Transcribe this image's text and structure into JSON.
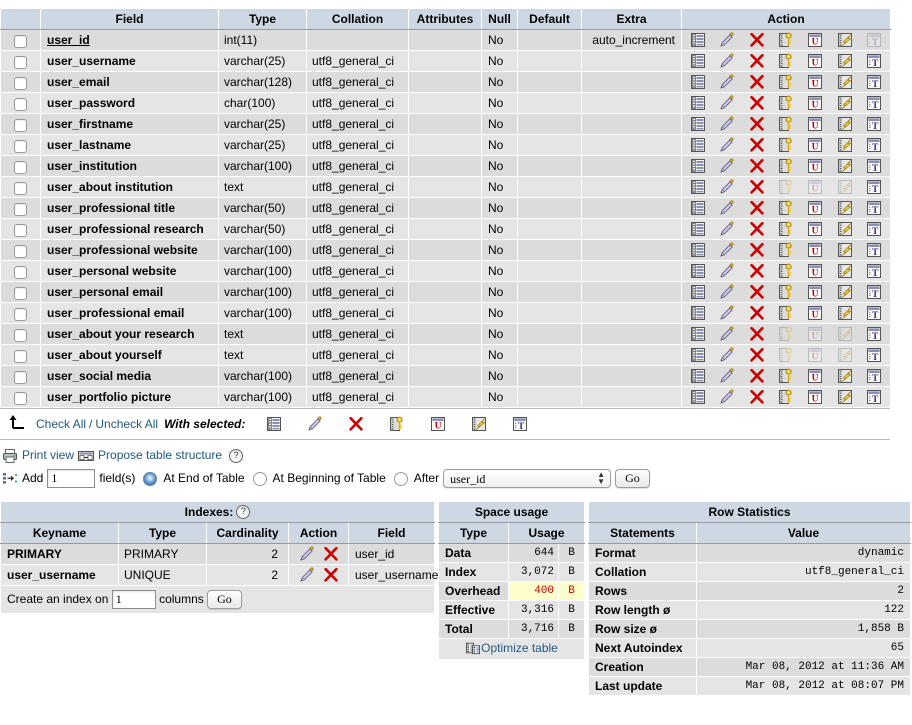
{
  "structure": {
    "columns": [
      "",
      "Field",
      "Type",
      "Collation",
      "Attributes",
      "Null",
      "Default",
      "Extra",
      "Action"
    ],
    "rows": [
      {
        "field": "user_id",
        "type": "int(11)",
        "collation": "",
        "attributes": "",
        "null": "No",
        "default": "",
        "extra": "auto_increment",
        "primary_key": true,
        "disabled": [
          "fulltext"
        ]
      },
      {
        "field": "user_username",
        "type": "varchar(25)",
        "collation": "utf8_general_ci",
        "attributes": "",
        "null": "No",
        "default": "",
        "extra": "",
        "primary_key": false,
        "disabled": []
      },
      {
        "field": "user_email",
        "type": "varchar(128)",
        "collation": "utf8_general_ci",
        "attributes": "",
        "null": "No",
        "default": "",
        "extra": "",
        "primary_key": false,
        "disabled": []
      },
      {
        "field": "user_password",
        "type": "char(100)",
        "collation": "utf8_general_ci",
        "attributes": "",
        "null": "No",
        "default": "",
        "extra": "",
        "primary_key": false,
        "disabled": []
      },
      {
        "field": "user_firstname",
        "type": "varchar(25)",
        "collation": "utf8_general_ci",
        "attributes": "",
        "null": "No",
        "default": "",
        "extra": "",
        "primary_key": false,
        "disabled": []
      },
      {
        "field": "user_lastname",
        "type": "varchar(25)",
        "collation": "utf8_general_ci",
        "attributes": "",
        "null": "No",
        "default": "",
        "extra": "",
        "primary_key": false,
        "disabled": []
      },
      {
        "field": "user_institution",
        "type": "varchar(100)",
        "collation": "utf8_general_ci",
        "attributes": "",
        "null": "No",
        "default": "",
        "extra": "",
        "primary_key": false,
        "disabled": []
      },
      {
        "field": "user_about institution",
        "type": "text",
        "collation": "utf8_general_ci",
        "attributes": "",
        "null": "No",
        "default": "",
        "extra": "",
        "primary_key": false,
        "disabled": [
          "primary",
          "unique",
          "index"
        ]
      },
      {
        "field": "user_professional title",
        "type": "varchar(50)",
        "collation": "utf8_general_ci",
        "attributes": "",
        "null": "No",
        "default": "",
        "extra": "",
        "primary_key": false,
        "disabled": []
      },
      {
        "field": "user_professional research",
        "type": "varchar(50)",
        "collation": "utf8_general_ci",
        "attributes": "",
        "null": "No",
        "default": "",
        "extra": "",
        "primary_key": false,
        "disabled": []
      },
      {
        "field": "user_professional website",
        "type": "varchar(100)",
        "collation": "utf8_general_ci",
        "attributes": "",
        "null": "No",
        "default": "",
        "extra": "",
        "primary_key": false,
        "disabled": []
      },
      {
        "field": "user_personal website",
        "type": "varchar(100)",
        "collation": "utf8_general_ci",
        "attributes": "",
        "null": "No",
        "default": "",
        "extra": "",
        "primary_key": false,
        "disabled": []
      },
      {
        "field": "user_personal email",
        "type": "varchar(100)",
        "collation": "utf8_general_ci",
        "attributes": "",
        "null": "No",
        "default": "",
        "extra": "",
        "primary_key": false,
        "disabled": []
      },
      {
        "field": "user_professional email",
        "type": "varchar(100)",
        "collation": "utf8_general_ci",
        "attributes": "",
        "null": "No",
        "default": "",
        "extra": "",
        "primary_key": false,
        "disabled": []
      },
      {
        "field": "user_about your research",
        "type": "text",
        "collation": "utf8_general_ci",
        "attributes": "",
        "null": "No",
        "default": "",
        "extra": "",
        "primary_key": false,
        "disabled": [
          "primary",
          "unique",
          "index"
        ]
      },
      {
        "field": "user_about yourself",
        "type": "text",
        "collation": "utf8_general_ci",
        "attributes": "",
        "null": "No",
        "default": "",
        "extra": "",
        "primary_key": false,
        "disabled": [
          "primary",
          "unique",
          "index"
        ]
      },
      {
        "field": "user_social media",
        "type": "varchar(100)",
        "collation": "utf8_general_ci",
        "attributes": "",
        "null": "No",
        "default": "",
        "extra": "",
        "primary_key": false,
        "disabled": []
      },
      {
        "field": "user_portfolio picture",
        "type": "varchar(100)",
        "collation": "utf8_general_ci",
        "attributes": "",
        "null": "No",
        "default": "",
        "extra": "",
        "primary_key": false,
        "disabled": []
      }
    ],
    "action_icons": [
      "browse-icon",
      "edit-icon",
      "drop-icon",
      "primary-key-icon",
      "unique-icon",
      "index-icon",
      "fulltext-icon"
    ]
  },
  "with_selected": {
    "check_all": "Check All",
    "separator": "/",
    "uncheck_all": "Uncheck All",
    "label": "With selected:"
  },
  "operations": {
    "print_view": "Print view",
    "propose_structure": "Propose table structure",
    "help_mark": "?",
    "add_label": "Add",
    "add_count": "1",
    "fields_label": "field(s)",
    "at_end": "At End of Table",
    "at_beginning": "At Beginning of Table",
    "after": "After",
    "after_field": "user_id",
    "go": "Go"
  },
  "indexes": {
    "title": "Indexes:",
    "help_mark": "?",
    "columns": [
      "Keyname",
      "Type",
      "Cardinality",
      "Action",
      "Field"
    ],
    "rows": [
      {
        "keyname": "PRIMARY",
        "type": "PRIMARY",
        "cardinality": "2",
        "field": "user_id"
      },
      {
        "keyname": "user_username",
        "type": "UNIQUE",
        "cardinality": "2",
        "field": "user_username"
      }
    ],
    "create_label": "Create an index on",
    "create_count": "1",
    "columns_label": "columns",
    "go": "Go"
  },
  "space_usage": {
    "title": "Space usage",
    "columns": [
      "Type",
      "Usage"
    ],
    "rows": [
      {
        "type": "Data",
        "usage": "644",
        "unit": "B",
        "highlight": false
      },
      {
        "type": "Index",
        "usage": "3,072",
        "unit": "B",
        "highlight": false
      },
      {
        "type": "Overhead",
        "usage": "400",
        "unit": "B",
        "highlight": true
      },
      {
        "type": "Effective",
        "usage": "3,316",
        "unit": "B",
        "highlight": false
      },
      {
        "type": "Total",
        "usage": "3,716",
        "unit": "B",
        "highlight": false
      }
    ],
    "optimize": "Optimize table"
  },
  "row_statistics": {
    "title": "Row Statistics",
    "columns": [
      "Statements",
      "Value"
    ],
    "rows": [
      {
        "statement": "Format",
        "value": "dynamic"
      },
      {
        "statement": "Collation",
        "value": "utf8_general_ci"
      },
      {
        "statement": "Rows",
        "value": "2"
      },
      {
        "statement": "Row length ø",
        "value": "122"
      },
      {
        "statement": "Row size ø",
        "value": "1,858 B"
      },
      {
        "statement": "Next Autoindex",
        "value": "65"
      },
      {
        "statement": "Creation",
        "value": "Mar 08, 2012 at 11:36 AM"
      },
      {
        "statement": "Last update",
        "value": "Mar 08, 2012 at 08:07 PM"
      }
    ]
  },
  "colors": {
    "header_bg": "#cdd8e4",
    "row_odd": "#dcdcdc",
    "row_even": "#e5e5e5",
    "link": "#235a81",
    "drop_red": "#cc0000",
    "highlight_bg": "#ffffcc"
  }
}
